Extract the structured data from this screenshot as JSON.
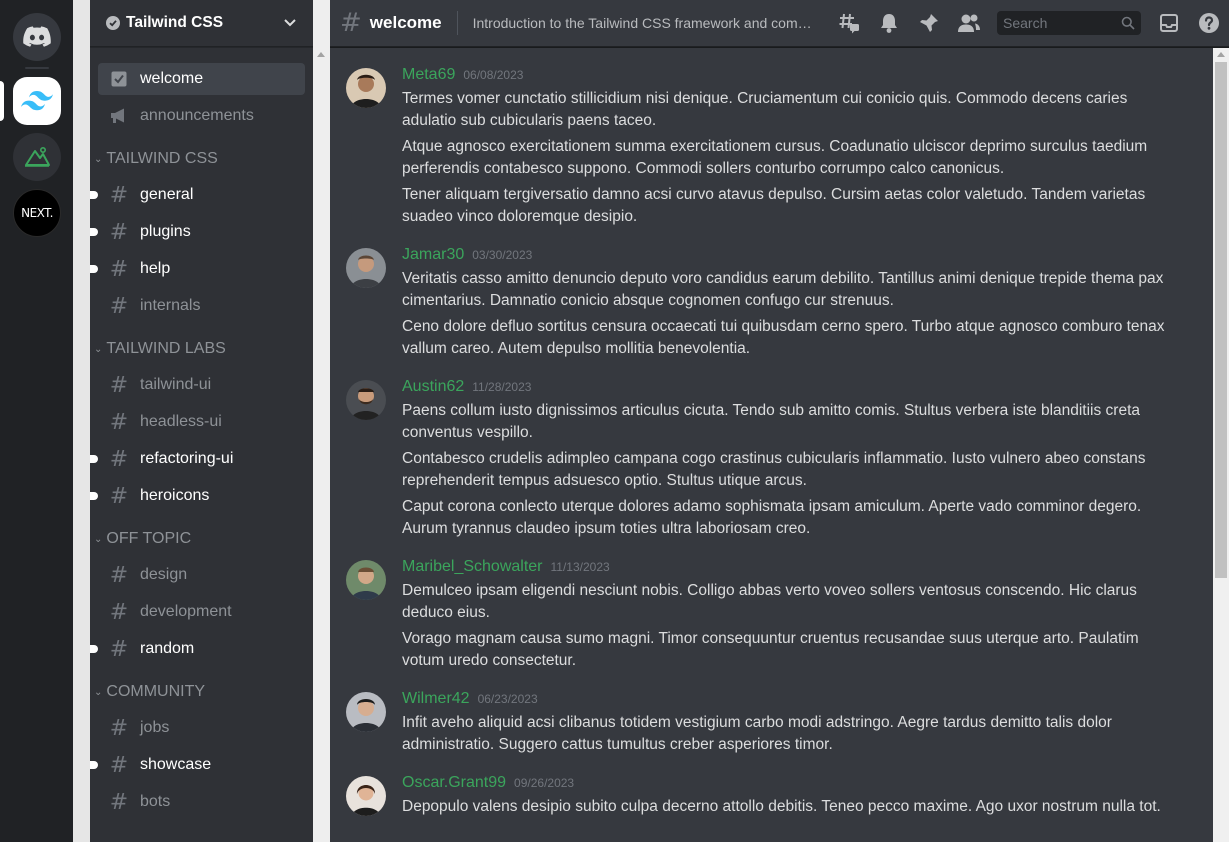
{
  "servers": [
    {
      "name": "Discord Home",
      "icon": "discord-logo-icon"
    },
    {
      "name": "Tailwind CSS",
      "icon": "tailwind-logo-icon",
      "active": true
    },
    {
      "name": "Remix",
      "icon": "remix-logo-icon"
    },
    {
      "name": "Next.js",
      "icon": "next-logo-icon",
      "label": "NEXT."
    }
  ],
  "sidebar": {
    "server_name": "Tailwind CSS",
    "top_channels": [
      {
        "label": "welcome",
        "icon": "checkbox-icon"
      },
      {
        "label": "announcements",
        "icon": "megaphone-icon"
      }
    ],
    "categories": [
      {
        "label": "Tailwind CSS",
        "channels": [
          "general",
          "plugins",
          "help",
          "internals"
        ]
      },
      {
        "label": "Tailwind Labs",
        "channels": [
          "tailwind-ui",
          "headless-ui",
          "refactoring-ui",
          "heroicons"
        ]
      },
      {
        "label": "Off Topic",
        "channels": [
          "design",
          "development",
          "random"
        ]
      },
      {
        "label": "Community",
        "channels": [
          "jobs",
          "showcase",
          "bots"
        ]
      }
    ]
  },
  "header": {
    "channel_name": "welcome",
    "topic": "Introduction to the Tailwind CSS framework and community.",
    "search_placeholder": "Search"
  },
  "messages": [
    {
      "user": "Meta69",
      "date": "06/08/2023",
      "lines": [
        "Termes vomer cunctatio stillicidium nisi denique. Cruciamentum cui conicio quis. Commodo decens caries adulatio sub cubicularis paens taceo.",
        "Atque agnosco exercitationem summa exercitationem cursus. Coadunatio ulciscor deprimo surculus taedium perferendis contabesco suppono. Commodi sollers conturbo corrumpo calco canonicus.",
        "Tener aliquam tergiversatio damno acsi curvo atavus depulso. Cursim aetas color valetudo. Tandem varietas suadeo vinco doloremque desipio."
      ]
    },
    {
      "user": "Jamar30",
      "date": "03/30/2023",
      "lines": [
        "Veritatis casso amitto denuncio deputo voro candidus earum debilito. Tantillus animi denique trepide thema pax cimentarius. Damnatio conicio absque cognomen confugo cur strenuus.",
        "Ceno dolore defluo sortitus censura occaecati tui quibusdam cerno spero. Turbo atque agnosco comburo tenax vallum careo. Autem depulso mollitia benevolentia."
      ]
    },
    {
      "user": "Austin62",
      "date": "11/28/2023",
      "lines": [
        "Paens collum iusto dignissimos articulus cicuta. Tendo sub amitto comis. Stultus verbera iste blanditiis creta conventus vespillo.",
        "Contabesco crudelis adimpleo campana cogo crastinus cubicularis inflammatio. Iusto vulnero abeo constans reprehenderit tempus adsuesco optio. Stultus utique arcus.",
        "Caput corona conlecto uterque dolores adamo sophismata ipsam amiculum. Aperte vado comminor degero. Aurum tyrannus claudeo ipsum toties ultra laboriosam creo."
      ]
    },
    {
      "user": "Maribel_Schowalter",
      "date": "11/13/2023",
      "lines": [
        "Demulceo ipsam eligendi nesciunt nobis. Colligo abbas verto voveo sollers ventosus conscendo. Hic clarus deduco eius.",
        "Vorago magnam causa sumo magni. Timor consequuntur cruentus recusandae suus uterque arto. Paulatim votum uredo consectetur."
      ]
    },
    {
      "user": "Wilmer42",
      "date": "06/23/2023",
      "lines": [
        "Infit aveho aliquid acsi clibanus totidem vestigium carbo modi adstringo. Aegre tardus demitto talis dolor administratio. Suggero cattus tumultus creber asperiores timor."
      ]
    },
    {
      "user": "Oscar.Grant99",
      "date": "09/26/2023",
      "lines": [
        "Depopulo valens desipio subito culpa decerno attollo debitis. Teneo pecco maxime. Ago uxor nostrum nulla tot."
      ]
    }
  ],
  "colors": {
    "username": "#3ba55c",
    "bg_main": "#36393f",
    "bg_sidebar": "#2f3136",
    "bg_rail": "#202225"
  }
}
